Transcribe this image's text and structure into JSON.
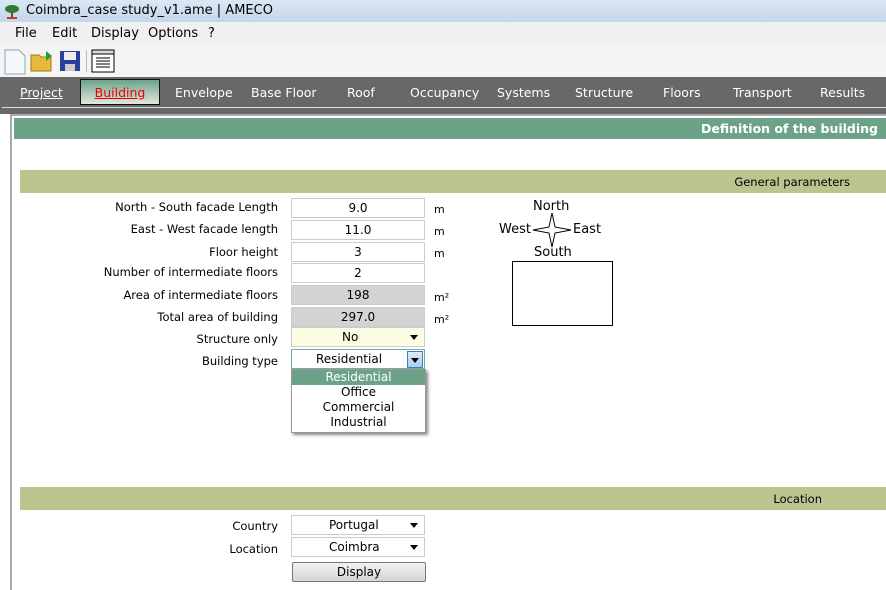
{
  "window": {
    "title": "Coimbra_case study_v1.ame | AMECO"
  },
  "menu": [
    "File",
    "Edit",
    "Display",
    "Options",
    "?"
  ],
  "toolbar": {
    "icons": [
      "new-file-icon",
      "open-folder-icon",
      "save-icon",
      "report-icon"
    ]
  },
  "tabs": [
    "Project",
    "Building",
    "Envelope",
    "Base Floor",
    "Roof",
    "Occupancy",
    "Systems",
    "Structure",
    "Floors",
    "Transport",
    "Results"
  ],
  "active_tab": "Building",
  "header": "Definition of the building",
  "general": {
    "title": "General parameters",
    "fields": [
      {
        "label": "North - South facade Length",
        "value": "9.0",
        "unit": "m"
      },
      {
        "label": "East - West facade length",
        "value": "11.0",
        "unit": "m"
      },
      {
        "label": "Floor height",
        "value": "3",
        "unit": "m"
      },
      {
        "label": "Number of intermediate floors",
        "value": "2",
        "unit": ""
      },
      {
        "label": "Area of intermediate floors",
        "value": "198",
        "unit": "m²"
      },
      {
        "label": "Total area of building",
        "value": "297.0",
        "unit": "m²"
      },
      {
        "label": "Structure only",
        "value": "No"
      },
      {
        "label": "Building type",
        "value": "Residential"
      }
    ],
    "building_type_options": [
      "Residential",
      "Office",
      "Commercial",
      "Industrial"
    ],
    "compass": {
      "north": "North",
      "south": "South",
      "east": "East",
      "west": "West"
    }
  },
  "location": {
    "title": "Location",
    "country_label": "Country",
    "country": "Portugal",
    "location_label": "Location",
    "location": "Coimbra",
    "display_button": "Display"
  },
  "colors": {
    "header": "#6ca388",
    "band": "#bcc58f",
    "tabbar": "#686868",
    "active_tab_text": "#e00000"
  }
}
